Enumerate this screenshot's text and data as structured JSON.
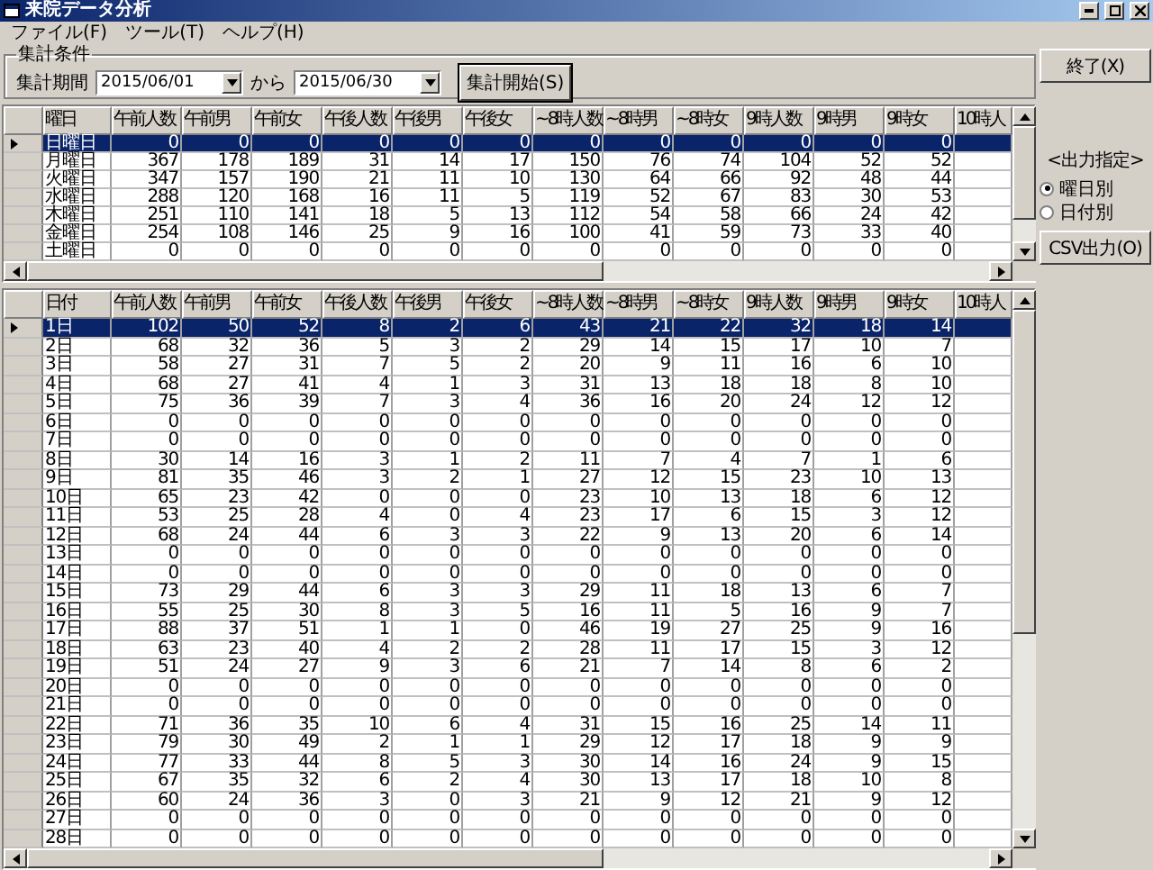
{
  "window": {
    "title": "来院データ分析"
  },
  "menu": [
    "ファイル(F)",
    "ツール(T)",
    "ヘルプ(H)"
  ],
  "criteria": {
    "legend": "集計条件",
    "period_label": "集計期間",
    "start_date": "2015/06/01",
    "separator": "から",
    "end_date": "2015/06/30",
    "start_button": "集計開始(S)"
  },
  "exit_button": "終了(X)",
  "output": {
    "legend": "<出力指定>",
    "options": [
      {
        "label": "曜日別",
        "selected": true
      },
      {
        "label": "日付別",
        "selected": false
      }
    ],
    "csv_button": "CSV出力(O)"
  },
  "weekday_table": {
    "columns": [
      "曜日",
      "午前人数",
      "午前男",
      "午前女",
      "午後人数",
      "午後男",
      "午後女",
      "~8時人数",
      "~8時男",
      "~8時女",
      "9時人数",
      "9時男",
      "9時女",
      "10時人"
    ],
    "rows": [
      {
        "selected": true,
        "cells": [
          "日曜日",
          "0",
          "0",
          "0",
          "0",
          "0",
          "0",
          "0",
          "0",
          "0",
          "0",
          "0",
          "0"
        ]
      },
      {
        "selected": false,
        "cells": [
          "月曜日",
          "367",
          "178",
          "189",
          "31",
          "14",
          "17",
          "150",
          "76",
          "74",
          "104",
          "52",
          "52"
        ]
      },
      {
        "selected": false,
        "cells": [
          "火曜日",
          "347",
          "157",
          "190",
          "21",
          "11",
          "10",
          "130",
          "64",
          "66",
          "92",
          "48",
          "44"
        ]
      },
      {
        "selected": false,
        "cells": [
          "水曜日",
          "288",
          "120",
          "168",
          "16",
          "11",
          "5",
          "119",
          "52",
          "67",
          "83",
          "30",
          "53"
        ]
      },
      {
        "selected": false,
        "cells": [
          "木曜日",
          "251",
          "110",
          "141",
          "18",
          "5",
          "13",
          "112",
          "54",
          "58",
          "66",
          "24",
          "42"
        ]
      },
      {
        "selected": false,
        "cells": [
          "金曜日",
          "254",
          "108",
          "146",
          "25",
          "9",
          "16",
          "100",
          "41",
          "59",
          "73",
          "33",
          "40"
        ]
      },
      {
        "selected": false,
        "cells": [
          "土曜日",
          "0",
          "0",
          "0",
          "0",
          "0",
          "0",
          "0",
          "0",
          "0",
          "0",
          "0",
          "0"
        ]
      }
    ]
  },
  "date_table": {
    "columns": [
      "日付",
      "午前人数",
      "午前男",
      "午前女",
      "午後人数",
      "午後男",
      "午後女",
      "~8時人数",
      "~8時男",
      "~8時女",
      "9時人数",
      "9時男",
      "9時女",
      "10時人"
    ],
    "rows": [
      {
        "selected": true,
        "cells": [
          "1日",
          "102",
          "50",
          "52",
          "8",
          "2",
          "6",
          "43",
          "21",
          "22",
          "32",
          "18",
          "14"
        ]
      },
      {
        "selected": false,
        "cells": [
          "2日",
          "68",
          "32",
          "36",
          "5",
          "3",
          "2",
          "29",
          "14",
          "15",
          "17",
          "10",
          "7"
        ]
      },
      {
        "selected": false,
        "cells": [
          "3日",
          "58",
          "27",
          "31",
          "7",
          "5",
          "2",
          "20",
          "9",
          "11",
          "16",
          "6",
          "10"
        ]
      },
      {
        "selected": false,
        "cells": [
          "4日",
          "68",
          "27",
          "41",
          "4",
          "1",
          "3",
          "31",
          "13",
          "18",
          "18",
          "8",
          "10"
        ]
      },
      {
        "selected": false,
        "cells": [
          "5日",
          "75",
          "36",
          "39",
          "7",
          "3",
          "4",
          "36",
          "16",
          "20",
          "24",
          "12",
          "12"
        ]
      },
      {
        "selected": false,
        "cells": [
          "6日",
          "0",
          "0",
          "0",
          "0",
          "0",
          "0",
          "0",
          "0",
          "0",
          "0",
          "0",
          "0"
        ]
      },
      {
        "selected": false,
        "cells": [
          "7日",
          "0",
          "0",
          "0",
          "0",
          "0",
          "0",
          "0",
          "0",
          "0",
          "0",
          "0",
          "0"
        ]
      },
      {
        "selected": false,
        "cells": [
          "8日",
          "30",
          "14",
          "16",
          "3",
          "1",
          "2",
          "11",
          "7",
          "4",
          "7",
          "1",
          "6"
        ]
      },
      {
        "selected": false,
        "cells": [
          "9日",
          "81",
          "35",
          "46",
          "3",
          "2",
          "1",
          "27",
          "12",
          "15",
          "23",
          "10",
          "13"
        ]
      },
      {
        "selected": false,
        "cells": [
          "10日",
          "65",
          "23",
          "42",
          "0",
          "0",
          "0",
          "23",
          "10",
          "13",
          "18",
          "6",
          "12"
        ]
      },
      {
        "selected": false,
        "cells": [
          "11日",
          "53",
          "25",
          "28",
          "4",
          "0",
          "4",
          "23",
          "17",
          "6",
          "15",
          "3",
          "12"
        ]
      },
      {
        "selected": false,
        "cells": [
          "12日",
          "68",
          "24",
          "44",
          "6",
          "3",
          "3",
          "22",
          "9",
          "13",
          "20",
          "6",
          "14"
        ]
      },
      {
        "selected": false,
        "cells": [
          "13日",
          "0",
          "0",
          "0",
          "0",
          "0",
          "0",
          "0",
          "0",
          "0",
          "0",
          "0",
          "0"
        ]
      },
      {
        "selected": false,
        "cells": [
          "14日",
          "0",
          "0",
          "0",
          "0",
          "0",
          "0",
          "0",
          "0",
          "0",
          "0",
          "0",
          "0"
        ]
      },
      {
        "selected": false,
        "cells": [
          "15日",
          "73",
          "29",
          "44",
          "6",
          "3",
          "3",
          "29",
          "11",
          "18",
          "13",
          "6",
          "7"
        ]
      },
      {
        "selected": false,
        "cells": [
          "16日",
          "55",
          "25",
          "30",
          "8",
          "3",
          "5",
          "16",
          "11",
          "5",
          "16",
          "9",
          "7"
        ]
      },
      {
        "selected": false,
        "cells": [
          "17日",
          "88",
          "37",
          "51",
          "1",
          "1",
          "0",
          "46",
          "19",
          "27",
          "25",
          "9",
          "16"
        ]
      },
      {
        "selected": false,
        "cells": [
          "18日",
          "63",
          "23",
          "40",
          "4",
          "2",
          "2",
          "28",
          "11",
          "17",
          "15",
          "3",
          "12"
        ]
      },
      {
        "selected": false,
        "cells": [
          "19日",
          "51",
          "24",
          "27",
          "9",
          "3",
          "6",
          "21",
          "7",
          "14",
          "8",
          "6",
          "2"
        ]
      },
      {
        "selected": false,
        "cells": [
          "20日",
          "0",
          "0",
          "0",
          "0",
          "0",
          "0",
          "0",
          "0",
          "0",
          "0",
          "0",
          "0"
        ]
      },
      {
        "selected": false,
        "cells": [
          "21日",
          "0",
          "0",
          "0",
          "0",
          "0",
          "0",
          "0",
          "0",
          "0",
          "0",
          "0",
          "0"
        ]
      },
      {
        "selected": false,
        "cells": [
          "22日",
          "71",
          "36",
          "35",
          "10",
          "6",
          "4",
          "31",
          "15",
          "16",
          "25",
          "14",
          "11"
        ]
      },
      {
        "selected": false,
        "cells": [
          "23日",
          "79",
          "30",
          "49",
          "2",
          "1",
          "1",
          "29",
          "12",
          "17",
          "18",
          "9",
          "9"
        ]
      },
      {
        "selected": false,
        "cells": [
          "24日",
          "77",
          "33",
          "44",
          "8",
          "5",
          "3",
          "30",
          "14",
          "16",
          "24",
          "9",
          "15"
        ]
      },
      {
        "selected": false,
        "cells": [
          "25日",
          "67",
          "35",
          "32",
          "6",
          "2",
          "4",
          "30",
          "13",
          "17",
          "18",
          "10",
          "8"
        ]
      },
      {
        "selected": false,
        "cells": [
          "26日",
          "60",
          "24",
          "36",
          "3",
          "0",
          "3",
          "21",
          "9",
          "12",
          "21",
          "9",
          "12"
        ]
      },
      {
        "selected": false,
        "cells": [
          "27日",
          "0",
          "0",
          "0",
          "0",
          "0",
          "0",
          "0",
          "0",
          "0",
          "0",
          "0",
          "0"
        ]
      },
      {
        "selected": false,
        "cells": [
          "28日",
          "0",
          "0",
          "0",
          "0",
          "0",
          "0",
          "0",
          "0",
          "0",
          "0",
          "0",
          "0"
        ]
      }
    ]
  }
}
